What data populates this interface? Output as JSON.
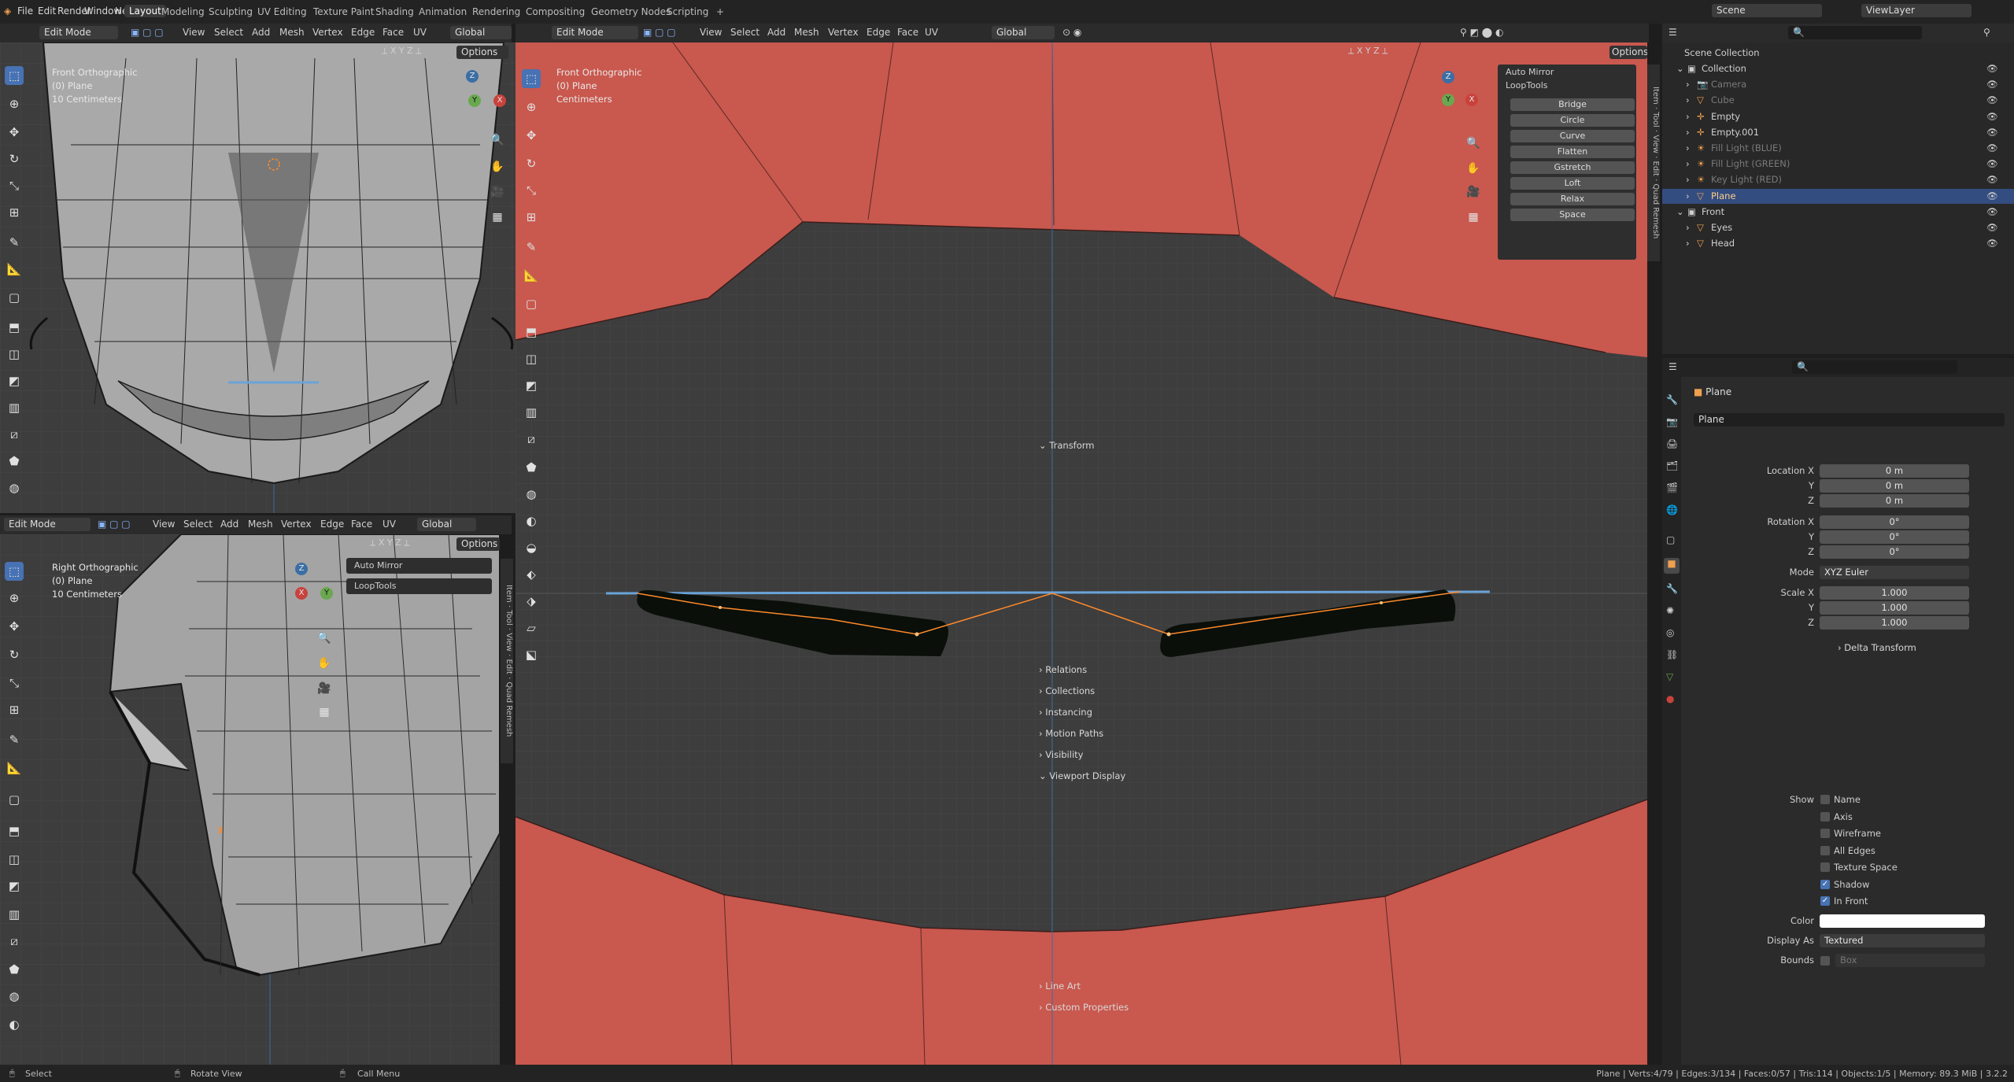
{
  "topbar": {
    "menus": [
      "File",
      "Edit",
      "Render",
      "Window",
      "Help"
    ],
    "workspaces": [
      "Layout",
      "Modeling",
      "Sculpting",
      "UV Editing",
      "Texture Paint",
      "Shading",
      "Animation",
      "Rendering",
      "Compositing",
      "Geometry Nodes",
      "Scripting"
    ],
    "active_workspace": "Layout",
    "add_tab": "+",
    "scene": "Scene",
    "view_layer": "ViewLayer"
  },
  "viewport_header": {
    "mode": "Edit Mode",
    "menus": [
      "View",
      "Select",
      "Add",
      "Mesh",
      "Vertex",
      "Edge",
      "Face",
      "UV"
    ],
    "orientation": "Global",
    "options": "Options",
    "axes": [
      "X",
      "Y",
      "Z"
    ]
  },
  "vp_top_left": {
    "view": "Front Orthographic",
    "object": "(0) Plane",
    "scale": "10 Centimeters"
  },
  "vp_bottom_left": {
    "view": "Right Orthographic",
    "object": "(0) Plane",
    "scale": "10 Centimeters",
    "panels": [
      "Auto Mirror",
      "LoopTools"
    ]
  },
  "vp_main": {
    "view": "Front Orthographic",
    "object": "(0) Plane",
    "scale": "Centimeters",
    "auto_mirror": "Auto Mirror",
    "looptools": "LoopTools",
    "looptools_items": [
      "Bridge",
      "Circle",
      "Curve",
      "Flatten",
      "Gstretch",
      "Loft",
      "Relax",
      "Space"
    ]
  },
  "side_tabs": [
    "Item",
    "Tool",
    "View",
    "Edit",
    "Quad Remesh"
  ],
  "gizmo": {
    "x": "X",
    "y": "Y",
    "z": "Z"
  },
  "outliner": {
    "root": "Scene Collection",
    "items": [
      {
        "name": "Collection",
        "level": 1,
        "kind": "collection"
      },
      {
        "name": "Camera",
        "level": 2,
        "kind": "camera",
        "dim": true
      },
      {
        "name": "Cube",
        "level": 2,
        "kind": "mesh",
        "dim": true
      },
      {
        "name": "Empty",
        "level": 2,
        "kind": "empty"
      },
      {
        "name": "Empty.001",
        "level": 2,
        "kind": "empty"
      },
      {
        "name": "Fill Light (BLUE)",
        "level": 2,
        "kind": "light",
        "dim": true
      },
      {
        "name": "Fill Light (GREEN)",
        "level": 2,
        "kind": "light",
        "dim": true
      },
      {
        "name": "Key Light (RED)",
        "level": 2,
        "kind": "light",
        "dim": true
      },
      {
        "name": "Plane",
        "level": 2,
        "kind": "mesh",
        "selected": true
      },
      {
        "name": "Front",
        "level": 1,
        "kind": "collection"
      },
      {
        "name": "Eyes",
        "level": 2,
        "kind": "mesh"
      },
      {
        "name": "Head",
        "level": 2,
        "kind": "mesh"
      }
    ]
  },
  "properties": {
    "object_name": "Plane",
    "datablock": "Plane",
    "transform": {
      "title": "Transform",
      "location": {
        "label": "Location X",
        "x": "0 m",
        "y": "0 m",
        "z": "0 m"
      },
      "rotation": {
        "label": "Rotation X",
        "x": "0°",
        "y": "0°",
        "z": "0°"
      },
      "mode": {
        "label": "Mode",
        "value": "XYZ Euler"
      },
      "scale": {
        "label": "Scale X",
        "x": "1.000",
        "y": "1.000",
        "z": "1.000"
      },
      "y": "Y",
      "z": "Z",
      "delta": "Delta Transform"
    },
    "sections": [
      "Relations",
      "Collections",
      "Instancing",
      "Motion Paths",
      "Visibility"
    ],
    "viewport_display": {
      "title": "Viewport Display",
      "show_label": "Show",
      "checks": [
        {
          "label": "Name",
          "on": false
        },
        {
          "label": "Axis",
          "on": false
        },
        {
          "label": "Wireframe",
          "on": false
        },
        {
          "label": "All Edges",
          "on": false
        },
        {
          "label": "Texture Space",
          "on": false
        },
        {
          "label": "Shadow",
          "on": true
        },
        {
          "label": "In Front",
          "on": true
        }
      ],
      "color_label": "Color",
      "display_as_label": "Display As",
      "display_as": "Textured",
      "bounds_label": "Bounds",
      "bounds": "Box"
    },
    "more_sections": [
      "Line Art",
      "Custom Properties"
    ]
  },
  "status": {
    "select": "Select",
    "rotate": "Rotate View",
    "menu": "Call Menu",
    "stats": "Plane | Verts:4/79 | Edges:3/134 | Faces:0/57 | Tris:114 | Objects:1/5 | Memory: 89.3 MiB | 3.2.2"
  },
  "colors": {
    "accent": "#4772b3",
    "lip": "#c9584e",
    "viewport_bg": "#3d3d3d",
    "edge_selected": "#ff8a2a"
  }
}
